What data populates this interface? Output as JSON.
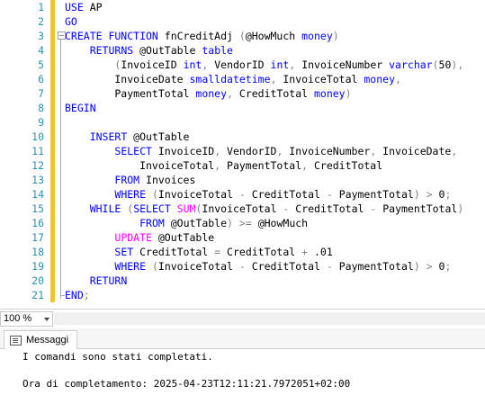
{
  "editor": {
    "lines": [
      {
        "n": "1",
        "segs": [
          {
            "t": "kw",
            "v": "USE"
          },
          {
            "t": "tx",
            "v": " AP"
          }
        ]
      },
      {
        "n": "2",
        "segs": [
          {
            "t": "kw",
            "v": "GO"
          }
        ]
      },
      {
        "n": "3",
        "segs": [
          {
            "t": "kw",
            "v": "CREATE FUNCTION"
          },
          {
            "t": "tx",
            "v": " fnCreditAdj "
          },
          {
            "t": "op",
            "v": "("
          },
          {
            "t": "tx",
            "v": "@HowMuch "
          },
          {
            "t": "kw",
            "v": "money"
          },
          {
            "t": "op",
            "v": ")"
          }
        ]
      },
      {
        "n": "4",
        "segs": [
          {
            "t": "tx",
            "v": "    "
          },
          {
            "t": "kw",
            "v": "RETURNS"
          },
          {
            "t": "tx",
            "v": " @OutTable "
          },
          {
            "t": "kw",
            "v": "table"
          }
        ]
      },
      {
        "n": "5",
        "segs": [
          {
            "t": "tx",
            "v": "        "
          },
          {
            "t": "op",
            "v": "("
          },
          {
            "t": "tx",
            "v": "InvoiceID "
          },
          {
            "t": "kw",
            "v": "int"
          },
          {
            "t": "op",
            "v": ","
          },
          {
            "t": "tx",
            "v": " VendorID "
          },
          {
            "t": "kw",
            "v": "int"
          },
          {
            "t": "op",
            "v": ","
          },
          {
            "t": "tx",
            "v": " InvoiceNumber "
          },
          {
            "t": "kw",
            "v": "varchar"
          },
          {
            "t": "op",
            "v": "("
          },
          {
            "t": "tx",
            "v": "50"
          },
          {
            "t": "op",
            "v": "),"
          }
        ]
      },
      {
        "n": "6",
        "segs": [
          {
            "t": "tx",
            "v": "        InvoiceDate "
          },
          {
            "t": "kw",
            "v": "smalldatetime"
          },
          {
            "t": "op",
            "v": ","
          },
          {
            "t": "tx",
            "v": " InvoiceTotal "
          },
          {
            "t": "kw",
            "v": "money"
          },
          {
            "t": "op",
            "v": ","
          }
        ]
      },
      {
        "n": "7",
        "segs": [
          {
            "t": "tx",
            "v": "        PaymentTotal "
          },
          {
            "t": "kw",
            "v": "money"
          },
          {
            "t": "op",
            "v": ","
          },
          {
            "t": "tx",
            "v": " CreditTotal "
          },
          {
            "t": "kw",
            "v": "money"
          },
          {
            "t": "op",
            "v": ")"
          }
        ]
      },
      {
        "n": "8",
        "segs": [
          {
            "t": "kw",
            "v": "BEGIN"
          }
        ]
      },
      {
        "n": "9",
        "segs": []
      },
      {
        "n": "10",
        "segs": [
          {
            "t": "tx",
            "v": "    "
          },
          {
            "t": "kw",
            "v": "INSERT"
          },
          {
            "t": "tx",
            "v": " @OutTable"
          }
        ]
      },
      {
        "n": "11",
        "segs": [
          {
            "t": "tx",
            "v": "        "
          },
          {
            "t": "kw",
            "v": "SELECT"
          },
          {
            "t": "tx",
            "v": " InvoiceID"
          },
          {
            "t": "op",
            "v": ","
          },
          {
            "t": "tx",
            "v": " VendorID"
          },
          {
            "t": "op",
            "v": ","
          },
          {
            "t": "tx",
            "v": " InvoiceNumber"
          },
          {
            "t": "op",
            "v": ","
          },
          {
            "t": "tx",
            "v": " InvoiceDate"
          },
          {
            "t": "op",
            "v": ","
          }
        ]
      },
      {
        "n": "12",
        "segs": [
          {
            "t": "tx",
            "v": "            InvoiceTotal"
          },
          {
            "t": "op",
            "v": ","
          },
          {
            "t": "tx",
            "v": " PaymentTotal"
          },
          {
            "t": "op",
            "v": ","
          },
          {
            "t": "tx",
            "v": " CreditTotal"
          }
        ]
      },
      {
        "n": "13",
        "segs": [
          {
            "t": "tx",
            "v": "        "
          },
          {
            "t": "kw",
            "v": "FROM"
          },
          {
            "t": "tx",
            "v": " Invoices"
          }
        ]
      },
      {
        "n": "14",
        "segs": [
          {
            "t": "tx",
            "v": "        "
          },
          {
            "t": "kw",
            "v": "WHERE"
          },
          {
            "t": "tx",
            "v": " "
          },
          {
            "t": "op",
            "v": "("
          },
          {
            "t": "tx",
            "v": "InvoiceTotal "
          },
          {
            "t": "op",
            "v": "-"
          },
          {
            "t": "tx",
            "v": " CreditTotal "
          },
          {
            "t": "op",
            "v": "-"
          },
          {
            "t": "tx",
            "v": " PaymentTotal"
          },
          {
            "t": "op",
            "v": ")"
          },
          {
            "t": "tx",
            "v": " "
          },
          {
            "t": "op",
            "v": ">"
          },
          {
            "t": "tx",
            "v": " 0"
          },
          {
            "t": "op",
            "v": ";"
          }
        ]
      },
      {
        "n": "15",
        "segs": [
          {
            "t": "tx",
            "v": "    "
          },
          {
            "t": "kw",
            "v": "WHILE"
          },
          {
            "t": "tx",
            "v": " "
          },
          {
            "t": "op",
            "v": "("
          },
          {
            "t": "kw",
            "v": "SELECT"
          },
          {
            "t": "tx",
            "v": " "
          },
          {
            "t": "fn",
            "v": "SUM"
          },
          {
            "t": "op",
            "v": "("
          },
          {
            "t": "tx",
            "v": "InvoiceTotal "
          },
          {
            "t": "op",
            "v": "-"
          },
          {
            "t": "tx",
            "v": " CreditTotal "
          },
          {
            "t": "op",
            "v": "-"
          },
          {
            "t": "tx",
            "v": " PaymentTotal"
          },
          {
            "t": "op",
            "v": ")"
          }
        ]
      },
      {
        "n": "16",
        "segs": [
          {
            "t": "tx",
            "v": "            "
          },
          {
            "t": "kw",
            "v": "FROM"
          },
          {
            "t": "tx",
            "v": " @OutTable"
          },
          {
            "t": "op",
            "v": ")"
          },
          {
            "t": "tx",
            "v": " "
          },
          {
            "t": "op",
            "v": ">="
          },
          {
            "t": "tx",
            "v": " @HowMuch"
          }
        ]
      },
      {
        "n": "17",
        "segs": [
          {
            "t": "tx",
            "v": "        "
          },
          {
            "t": "fn",
            "v": "UPDATE"
          },
          {
            "t": "tx",
            "v": " @OutTable"
          }
        ]
      },
      {
        "n": "18",
        "segs": [
          {
            "t": "tx",
            "v": "        "
          },
          {
            "t": "kw",
            "v": "SET"
          },
          {
            "t": "tx",
            "v": " CreditTotal "
          },
          {
            "t": "op",
            "v": "="
          },
          {
            "t": "tx",
            "v": " CreditTotal "
          },
          {
            "t": "op",
            "v": "+"
          },
          {
            "t": "tx",
            "v": " .01"
          }
        ]
      },
      {
        "n": "19",
        "segs": [
          {
            "t": "tx",
            "v": "        "
          },
          {
            "t": "kw",
            "v": "WHERE"
          },
          {
            "t": "tx",
            "v": " "
          },
          {
            "t": "op",
            "v": "("
          },
          {
            "t": "tx",
            "v": "InvoiceTotal "
          },
          {
            "t": "op",
            "v": "-"
          },
          {
            "t": "tx",
            "v": " CreditTotal "
          },
          {
            "t": "op",
            "v": "-"
          },
          {
            "t": "tx",
            "v": " PaymentTotal"
          },
          {
            "t": "op",
            "v": ")"
          },
          {
            "t": "tx",
            "v": " "
          },
          {
            "t": "op",
            "v": ">"
          },
          {
            "t": "tx",
            "v": " 0"
          },
          {
            "t": "op",
            "v": ";"
          }
        ]
      },
      {
        "n": "20",
        "segs": [
          {
            "t": "tx",
            "v": "    "
          },
          {
            "t": "kw",
            "v": "RETURN"
          }
        ]
      },
      {
        "n": "21",
        "segs": [
          {
            "t": "kw",
            "v": "END"
          },
          {
            "t": "op",
            "v": ";"
          }
        ]
      }
    ],
    "colors": {
      "keyword": "#0000ff",
      "function": "#ff00ff",
      "operator": "#808080",
      "text": "#000000",
      "line_number": "#2b91af",
      "change_marker": "#f2c230"
    },
    "fold_glyph": "−"
  },
  "statusbar": {
    "zoom": "100 %",
    "zoom_arrow_icon": "chevron-down-icon"
  },
  "results": {
    "tab_label": "Messaggi",
    "tab_icon": "messages-icon",
    "messages": [
      "I comandi sono stati completati.",
      "",
      "Ora di completamento: 2025-04-23T12:11:21.7972051+02:00"
    ]
  }
}
